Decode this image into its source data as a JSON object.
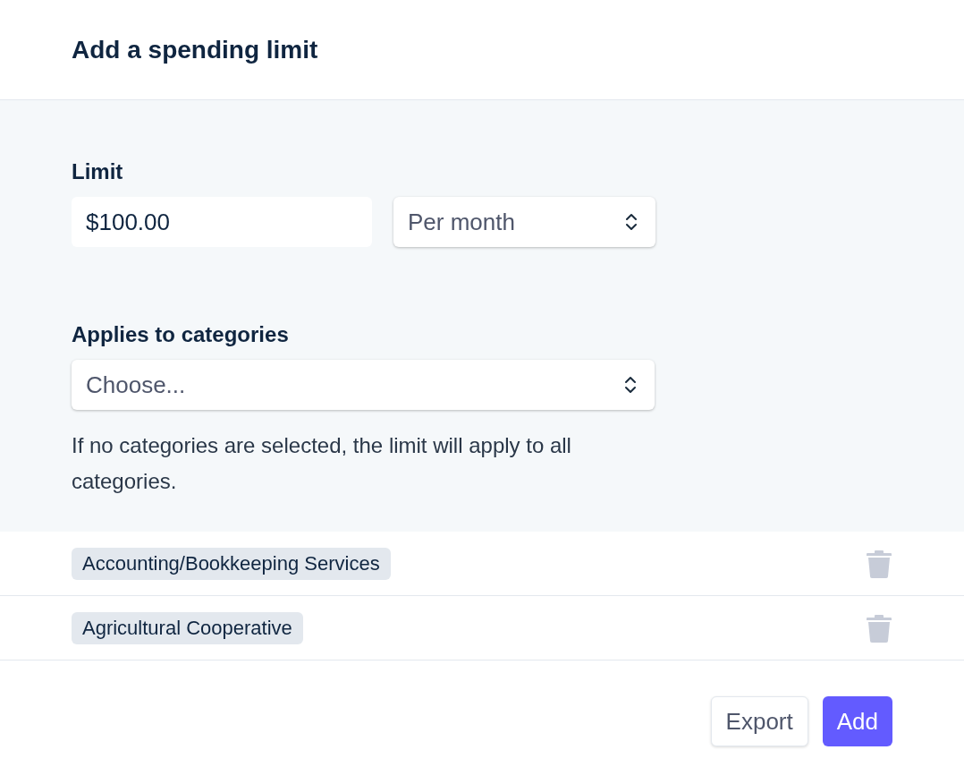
{
  "title": "Add a spending limit",
  "limit": {
    "label": "Limit",
    "amount": "$100.00",
    "period": "Per month"
  },
  "categories": {
    "label": "Applies to categories",
    "placeholder": "Choose...",
    "help": "If no categories are selected, the limit will apply to all categories."
  },
  "selected_categories": [
    {
      "name": "Accounting/Bookkeeping Services"
    },
    {
      "name": "Agricultural Cooperative"
    }
  ],
  "buttons": [
    {
      "label": "Export",
      "kind": "secondary"
    },
    {
      "label": "Add",
      "kind": "primary"
    }
  ]
}
